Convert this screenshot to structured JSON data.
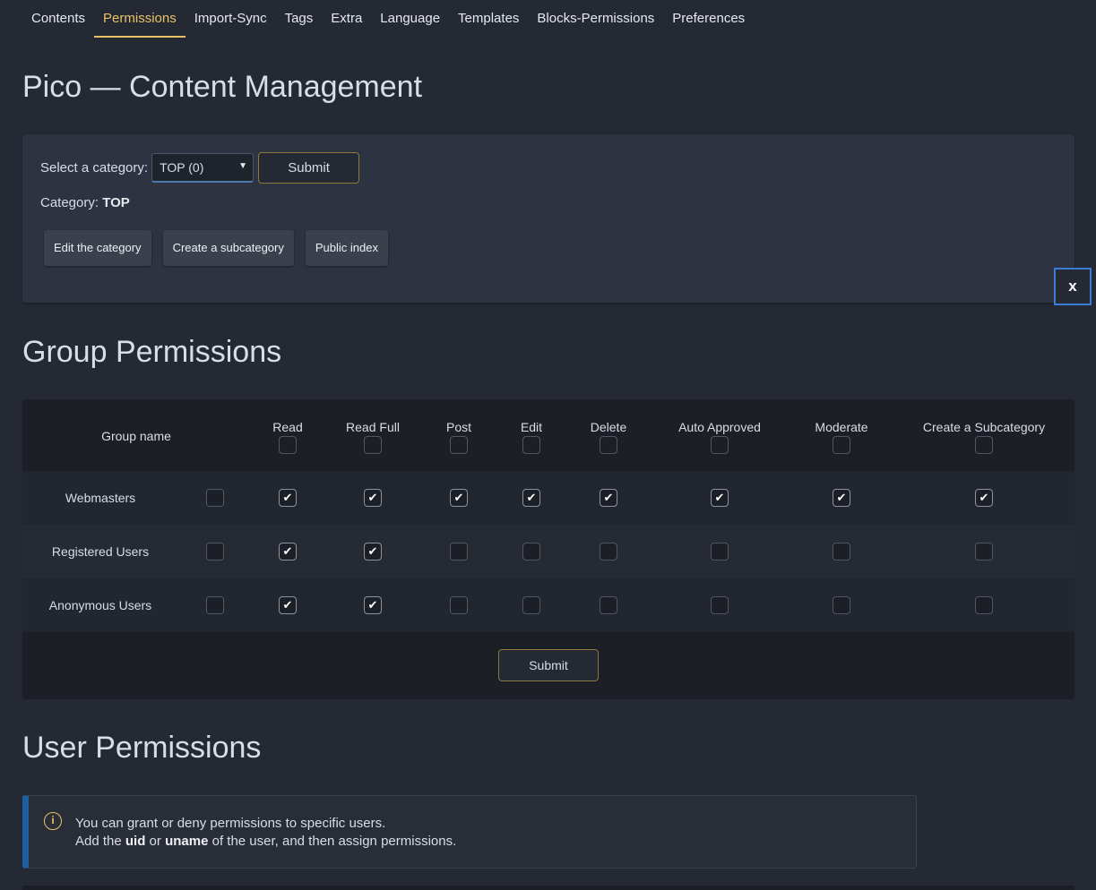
{
  "tabs": [
    {
      "label": "Contents"
    },
    {
      "label": "Permissions",
      "active": true
    },
    {
      "label": "Import-Sync"
    },
    {
      "label": "Tags"
    },
    {
      "label": "Extra"
    },
    {
      "label": "Language"
    },
    {
      "label": "Templates"
    },
    {
      "label": "Blocks-Permissions"
    },
    {
      "label": "Preferences"
    }
  ],
  "page_title": "Pico — Content Management",
  "category_panel": {
    "select_label": "Select a category:",
    "select_value": "TOP (0)",
    "submit_label": "Submit",
    "category_prefix": "Category:",
    "category_name": "TOP",
    "actions": [
      "Edit the category",
      "Create a subcategory",
      "Public index"
    ]
  },
  "close_label": "x",
  "group_permissions": {
    "title": "Group Permissions",
    "group_col_label": "Group name",
    "columns": [
      "Read",
      "Read Full",
      "Post",
      "Edit",
      "Delete",
      "Auto Approved",
      "Moderate",
      "Create a Subcategory"
    ],
    "header_checks": [
      false,
      false,
      false,
      false,
      false,
      false,
      false,
      false
    ],
    "rows": [
      {
        "name": "Webmasters",
        "all": false,
        "perms": [
          true,
          true,
          true,
          true,
          true,
          true,
          true,
          true
        ]
      },
      {
        "name": "Registered Users",
        "all": false,
        "perms": [
          true,
          true,
          false,
          false,
          false,
          false,
          false,
          false
        ]
      },
      {
        "name": "Anonymous Users",
        "all": false,
        "perms": [
          true,
          true,
          false,
          false,
          false,
          false,
          false,
          false
        ]
      }
    ],
    "submit_label": "Submit"
  },
  "user_permissions": {
    "title": "User Permissions",
    "info_line1": "You can grant or deny permissions to specific users.",
    "info_line2_pre": "Add the ",
    "info_uid": "uid",
    "info_or": " or ",
    "info_uname": "uname",
    "info_line2_post": " of the user, and then assign permissions."
  },
  "colors": {
    "accent": "#e9c268",
    "info_border": "#1f5f9e",
    "focus_blue": "#3a7bd5"
  },
  "icons": {
    "info": "info-circle-icon",
    "check": "check-icon",
    "dropdown": "caret-down-icon"
  }
}
